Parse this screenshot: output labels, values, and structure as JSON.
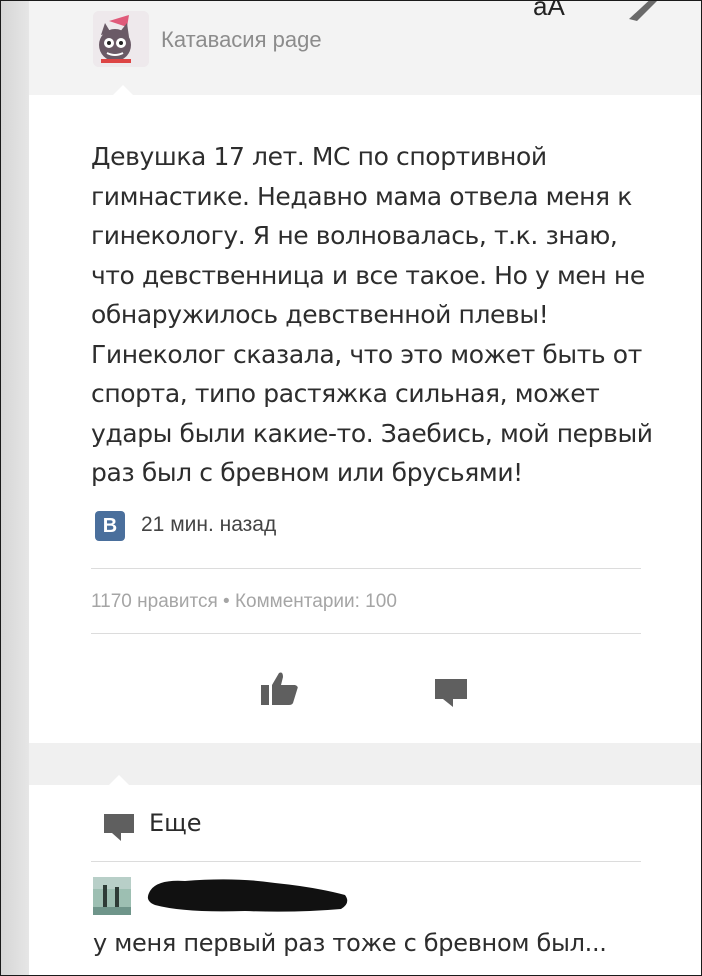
{
  "header": {
    "page_name": "Катавасия page",
    "font_toggle": "aA",
    "avatar_icon": "cat-avatar-icon",
    "edit_icon": "pencil-icon"
  },
  "post": {
    "text": "Девушка 17 лет. МС по спортивной гимнастике. Недавно мама отвела меня к гинекологу. Я не волновалась, т.к. знаю, что девственница и все такое. Но у мен не обнаружилось девственной плевы! Гинеколог сказала, что это может быть от спорта, типо растяжка сильная, может удары были какие-то. Заебись, мой первый раз был с бревном или брусьями!",
    "source_badge": "В",
    "time": "21 мин. назад",
    "stats": "1170 нравится • Комментарии: 100"
  },
  "actions": {
    "like_icon": "thumbs-up-icon",
    "comment_icon": "comment-icon",
    "more_label": "Еще"
  },
  "comment": {
    "text": "у меня первый раз тоже с бревном был..."
  },
  "colors": {
    "accent_vk": "#4a6f9c",
    "icon_gray": "#5f5f5f",
    "muted_text": "#a5a5a5"
  }
}
